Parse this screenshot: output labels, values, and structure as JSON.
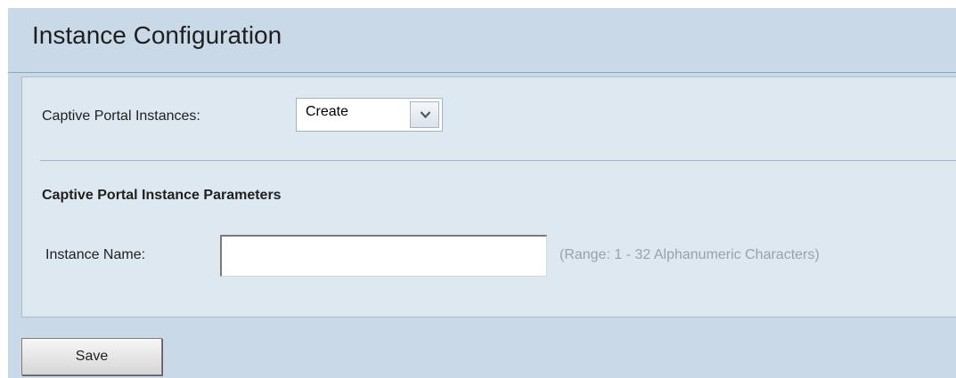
{
  "page": {
    "title": "Instance Configuration"
  },
  "instances": {
    "label": "Captive Portal Instances:",
    "selected": "Create",
    "arrow_icon": "chevron-down-icon"
  },
  "parameters": {
    "heading": "Captive Portal Instance Parameters",
    "instance_name_label": "Instance Name:",
    "instance_name_value": "",
    "range_hint": "(Range: 1 - 32 Alphanumeric Characters)"
  },
  "actions": {
    "save_label": "Save"
  },
  "colors": {
    "background": "#c9d9e8",
    "panel": "#dde8f1",
    "hint_text": "#9aa2a9"
  }
}
